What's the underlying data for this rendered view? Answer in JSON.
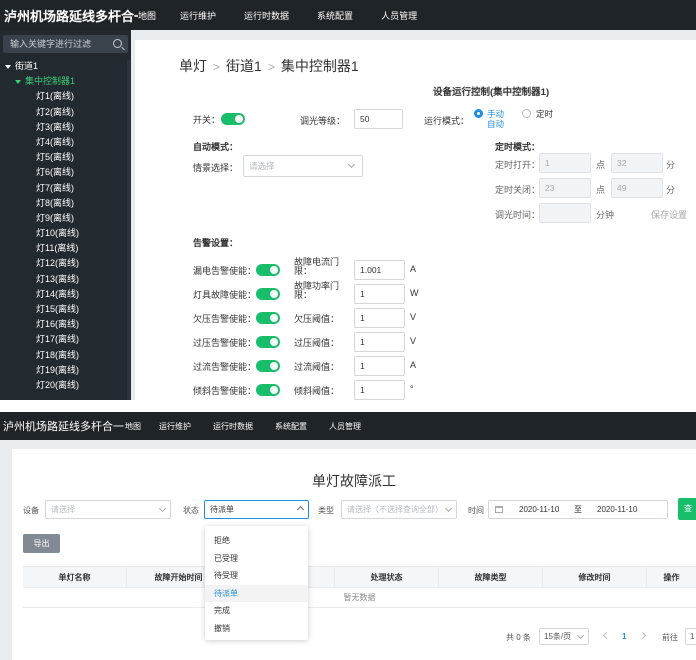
{
  "top": {
    "app_title": "泸州机场路延线多杆合一",
    "nav": [
      "地图",
      "运行维护",
      "运行时数据",
      "系统配置",
      "人员管理"
    ],
    "sidebar": {
      "search_placeholder": "输入关键字进行过滤",
      "tree": [
        {
          "label": "街道1",
          "level": 0
        },
        {
          "label": "集中控制器1",
          "level": 1
        },
        {
          "label": "灯1(离线)",
          "level": 2
        },
        {
          "label": "灯2(离线)",
          "level": 2
        },
        {
          "label": "灯3(离线)",
          "level": 2
        },
        {
          "label": "灯4(离线)",
          "level": 2
        },
        {
          "label": "灯5(离线)",
          "level": 2
        },
        {
          "label": "灯6(离线)",
          "level": 2
        },
        {
          "label": "灯7(离线)",
          "level": 2
        },
        {
          "label": "灯8(离线)",
          "level": 2
        },
        {
          "label": "灯9(离线)",
          "level": 2
        },
        {
          "label": "灯10(离线)",
          "level": 2
        },
        {
          "label": "灯11(离线)",
          "level": 2
        },
        {
          "label": "灯12(离线)",
          "level": 2
        },
        {
          "label": "灯13(离线)",
          "level": 2
        },
        {
          "label": "灯14(离线)",
          "level": 2
        },
        {
          "label": "灯15(离线)",
          "level": 2
        },
        {
          "label": "灯16(离线)",
          "level": 2
        },
        {
          "label": "灯17(离线)",
          "level": 2
        },
        {
          "label": "灯18(离线)",
          "level": 2
        },
        {
          "label": "灯19(离线)",
          "level": 2
        },
        {
          "label": "灯20(离线)",
          "level": 2
        }
      ]
    },
    "breadcrumb": [
      "单灯",
      "街道1",
      "集中控制器1"
    ],
    "section_title": "设备运行控制(集中控制器1)",
    "switch_label": "开关：",
    "dim_label": "调光等级：",
    "dim_value": "50",
    "mode_label": "运行模式：",
    "mode_manual": "手动",
    "mode_auto": "自动",
    "mode_timer": "定时",
    "auto_mode_title": "自动模式：",
    "scene_label": "情景选择：",
    "scene_placeholder": "请选择",
    "timer_mode_title": "定时模式：",
    "timer_on_label": "定时打开：",
    "timer_on_hour": "1",
    "timer_on_min": "32",
    "timer_off_label": "定时关闭：",
    "timer_off_hour": "23",
    "timer_off_min": "49",
    "point_unit": "点",
    "minute_unit": "分",
    "dim_time_label": "调光时间：",
    "dim_time_unit": "分钟",
    "save_label": "保存设置",
    "alarm_title": "告警设置：",
    "alarms": [
      {
        "enable": "漏电告警使能：",
        "param": "故障电流门限：",
        "value": "1.001",
        "unit": "A"
      },
      {
        "enable": "灯具故障使能：",
        "param": "故障功率门限：",
        "value": "1",
        "unit": "W"
      },
      {
        "enable": "欠压告警使能：",
        "param": "欠压阈值：",
        "value": "1",
        "unit": "V"
      },
      {
        "enable": "过压告警使能：",
        "param": "过压阈值：",
        "value": "1",
        "unit": "V"
      },
      {
        "enable": "过流告警使能：",
        "param": "过流阈值：",
        "value": "1",
        "unit": "A"
      },
      {
        "enable": "倾斜告警使能：",
        "param": "倾斜阈值：",
        "value": "1",
        "unit": "°"
      }
    ],
    "colors": {
      "accent_green": "#19be6b",
      "accent_blue": "#1e8fe0",
      "topbar": "#1f2429",
      "sidebar": "#22292f"
    }
  },
  "bottom": {
    "app_title": "泸州机场路延线多杆合一",
    "nav": [
      "地图",
      "运行维护",
      "运行时数据",
      "系统配置",
      "人员管理"
    ],
    "page_title": "单灯故障派工",
    "filters": {
      "device_label": "设备",
      "device_placeholder": "请选择",
      "status_label": "状态",
      "status_value": "待派单",
      "type_label": "类型",
      "type_placeholder": "请选择（不选择查询全部）",
      "time_label": "时间",
      "date_start": "2020-11-10",
      "date_to": "至",
      "date_end": "2020-11-10",
      "query_label": "查"
    },
    "export_label": "导出",
    "table_headers": [
      "单灯名称",
      "故障开始时间",
      "",
      "处理状态",
      "故障类型",
      "修改时间",
      "操作"
    ],
    "empty_text": "暂无数据",
    "status_options": [
      "拒绝",
      "已受理",
      "待受理",
      "待派单",
      "完成",
      "撤销"
    ],
    "selected_option": "待派单",
    "pager": {
      "total": "共 0 条",
      "page_size": "15条/页",
      "current": "1",
      "goto_label": "前往",
      "goto_value": "1"
    }
  }
}
